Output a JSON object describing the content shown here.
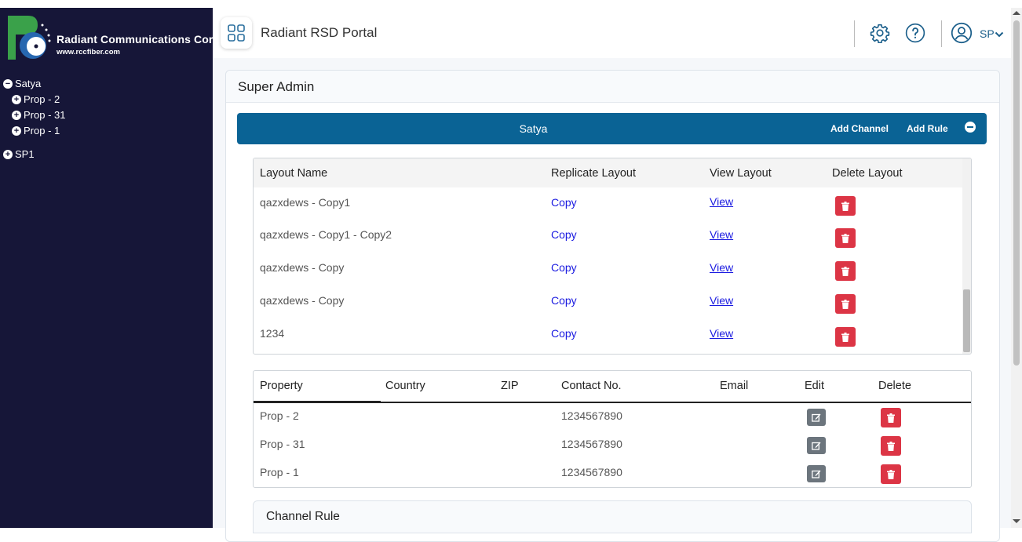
{
  "brand": {
    "name": "Radiant Communications Corp.",
    "url": "www.rccfiber.com",
    "colors": {
      "sidebar_bg": "#161638",
      "bar_bg": "#0a6395",
      "delete_btn": "#dc3545",
      "edit_btn": "#6c757d"
    }
  },
  "sidebar": {
    "tree": [
      {
        "label": "Satya",
        "state": "expanded",
        "children": [
          {
            "label": "Prop - 2",
            "state": "collapsed"
          },
          {
            "label": "Prop - 31",
            "state": "collapsed"
          },
          {
            "label": "Prop - 1",
            "state": "collapsed"
          }
        ]
      },
      {
        "label": "SP1",
        "state": "collapsed",
        "children": []
      }
    ]
  },
  "header": {
    "app_icon": "grid-apps-icon",
    "title": "Radiant RSD Portal",
    "settings_icon": "gear-icon",
    "help_icon": "help-circle-icon",
    "user_icon": "user-circle-icon",
    "user_initials": "SP",
    "dropdown_icon": "chevron-down-icon"
  },
  "main": {
    "card_title": "Super Admin",
    "bar": {
      "title": "Satya",
      "add_channel": "Add Channel",
      "add_rule": "Add Rule",
      "collapse_icon": "minus-circle-icon"
    },
    "layouts": {
      "headers": [
        "Layout Name",
        "Replicate Layout",
        "View Layout",
        "Delete Layout"
      ],
      "rows": [
        {
          "name": "qazxdews - Copy1",
          "copy": "Copy",
          "view": "View"
        },
        {
          "name": "qazxdews - Copy1 - Copy2",
          "copy": "Copy",
          "view": "View"
        },
        {
          "name": "qazxdews - Copy",
          "copy": "Copy",
          "view": "View"
        },
        {
          "name": "qazxdews - Copy",
          "copy": "Copy",
          "view": "View"
        },
        {
          "name": "1234",
          "copy": "Copy",
          "view": "View"
        }
      ]
    },
    "properties": {
      "headers": [
        "Property",
        "Country",
        "ZIP",
        "Contact No.",
        "Email",
        "Edit",
        "Delete"
      ],
      "rows": [
        {
          "property": "Prop - 2",
          "country": "",
          "zip": "",
          "contact": "1234567890",
          "email": ""
        },
        {
          "property": "Prop - 31",
          "country": "",
          "zip": "",
          "contact": "1234567890",
          "email": ""
        },
        {
          "property": "Prop - 1",
          "country": "",
          "zip": "",
          "contact": "1234567890",
          "email": ""
        }
      ]
    },
    "channel_rule": {
      "title": "Channel Rule"
    }
  }
}
